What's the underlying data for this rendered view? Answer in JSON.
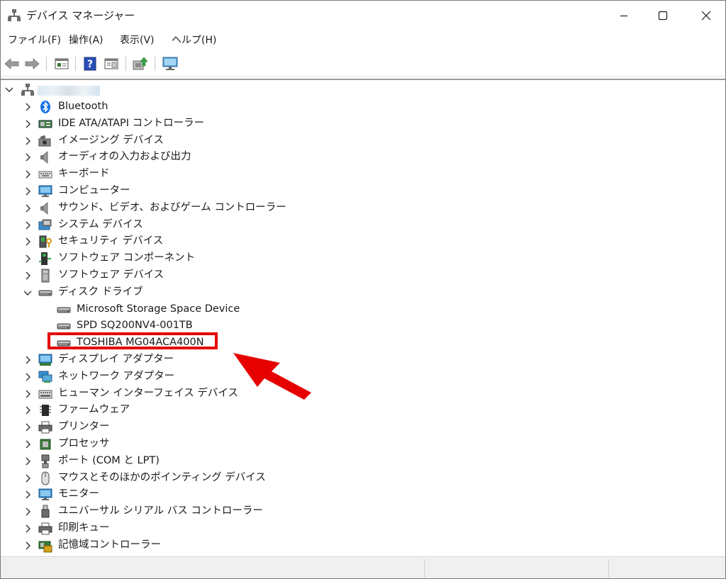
{
  "window": {
    "title": "デバイス マネージャー"
  },
  "menu": [
    "ファイル(F)",
    "操作(A)",
    "表示(V)",
    "ヘルプ(H)"
  ],
  "toolbar": [
    "back-button",
    "forward-button",
    "properties-button",
    "help-button",
    "view-button",
    "update-driver-button",
    "scan-hardware-button"
  ],
  "tree": {
    "root": {
      "label": ""
    },
    "categories": [
      {
        "label": "Bluetooth",
        "icon": "bluetooth-icon",
        "expanded": false
      },
      {
        "label": "IDE ATA/ATAPI コントローラー",
        "icon": "ide-controller-icon",
        "expanded": false
      },
      {
        "label": "イメージング デバイス",
        "icon": "camera-icon",
        "expanded": false
      },
      {
        "label": "オーディオの入力および出力",
        "icon": "speaker-icon",
        "expanded": false
      },
      {
        "label": "キーボード",
        "icon": "keyboard-icon",
        "expanded": false
      },
      {
        "label": "コンピューター",
        "icon": "monitor-icon",
        "expanded": false
      },
      {
        "label": "サウンド、ビデオ、およびゲーム コントローラー",
        "icon": "speaker-icon",
        "expanded": false
      },
      {
        "label": "システム デバイス",
        "icon": "system-device-icon",
        "expanded": false
      },
      {
        "label": "セキュリティ デバイス",
        "icon": "security-key-icon",
        "expanded": false
      },
      {
        "label": "ソフトウェア コンポーネント",
        "icon": "software-component-icon",
        "expanded": false
      },
      {
        "label": "ソフトウェア デバイス",
        "icon": "software-device-icon",
        "expanded": false
      },
      {
        "label": "ディスク ドライブ",
        "icon": "disk-drive-icon",
        "expanded": true,
        "children": [
          "Microsoft Storage Space Device",
          "SPD SQ200NV4-001TB",
          "TOSHIBA MG04ACA400N"
        ]
      },
      {
        "label": "ディスプレイ アダプター",
        "icon": "display-adapter-icon",
        "expanded": false
      },
      {
        "label": "ネットワーク アダプター",
        "icon": "network-adapter-icon",
        "expanded": false
      },
      {
        "label": "ヒューマン インターフェイス デバイス",
        "icon": "hid-icon",
        "expanded": false
      },
      {
        "label": "ファームウェア",
        "icon": "firmware-chip-icon",
        "expanded": false
      },
      {
        "label": "プリンター",
        "icon": "printer-icon",
        "expanded": false
      },
      {
        "label": "プロセッサ",
        "icon": "processor-icon",
        "expanded": false
      },
      {
        "label": "ポート (COM と LPT)",
        "icon": "port-icon",
        "expanded": false
      },
      {
        "label": "マウスとそのほかのポインティング デバイス",
        "icon": "mouse-icon",
        "expanded": false
      },
      {
        "label": "モニター",
        "icon": "monitor-icon",
        "expanded": false
      },
      {
        "label": "ユニバーサル シリアル バス コントローラー",
        "icon": "usb-icon",
        "expanded": false
      },
      {
        "label": "印刷キュー",
        "icon": "printer-icon",
        "expanded": false
      },
      {
        "label": "記憶域コントローラー",
        "icon": "storage-controller-icon",
        "expanded": false
      }
    ]
  },
  "annotation": {
    "highlighted_item": "TOSHIBA MG04ACA400N",
    "highlight_color": "#e60000"
  }
}
